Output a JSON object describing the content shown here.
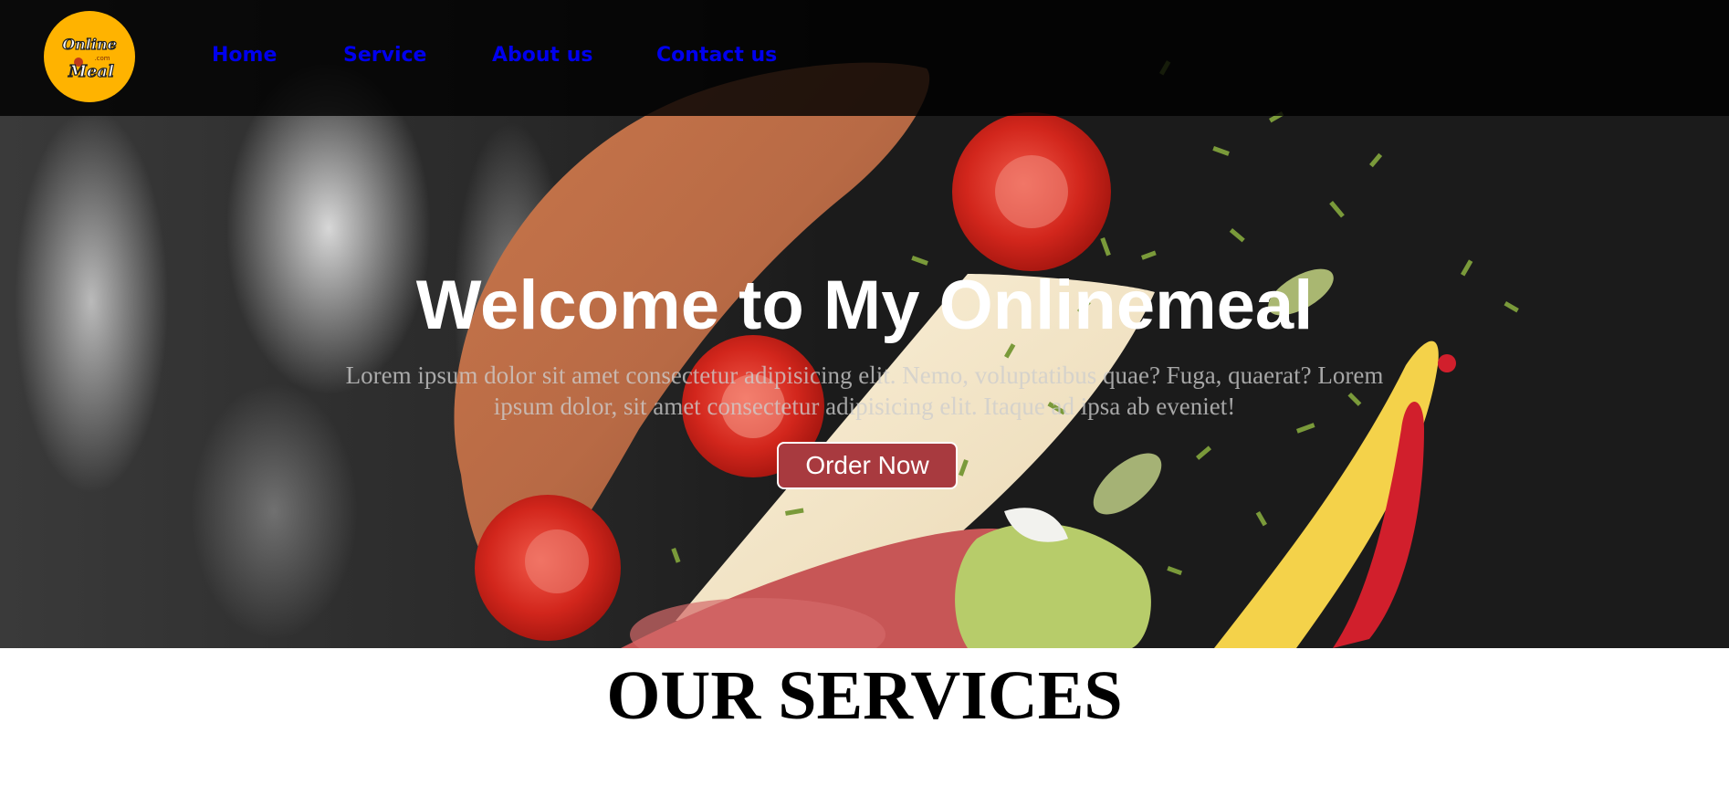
{
  "nav": {
    "logo_text": "Online.com Meal",
    "items": [
      {
        "label": "Home"
      },
      {
        "label": "Service"
      },
      {
        "label": "About us"
      },
      {
        "label": "Contact us"
      }
    ]
  },
  "hero": {
    "title": "Welcome to My Onlinemeal",
    "description": "Lorem ipsum dolor sit amet consectetur adipisicing elit. Nemo, voluptatibus quae? Fuga, quaerat? Lorem ipsum dolor, sit amet consectetur adipisicing elit. Itaque ad ipsa ab eveniet!",
    "button_label": "Order Now"
  },
  "services": {
    "title": "OUR SERVICES"
  },
  "colors": {
    "nav_link": "#0000ee",
    "logo_bg": "#ffb300",
    "button_bg": "#a83a3f"
  }
}
